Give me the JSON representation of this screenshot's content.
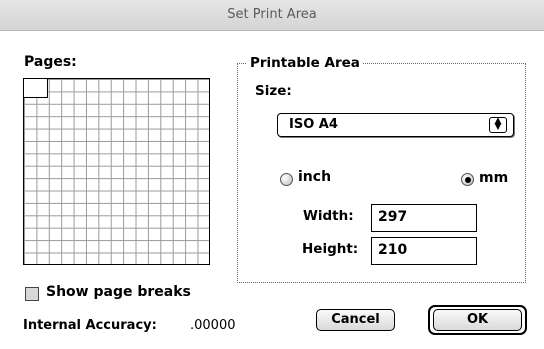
{
  "window": {
    "title": "Set Print Area"
  },
  "pages": {
    "label": "Pages:"
  },
  "printable_area": {
    "title": "Printable Area",
    "size_label": "Size:",
    "size_value": "ISO A4",
    "units": {
      "inch_label": "inch",
      "mm_label": "mm",
      "selected": "mm"
    },
    "width_label": "Width:",
    "width_value": "297",
    "height_label": "Height:",
    "height_value": "210"
  },
  "options": {
    "show_page_breaks_label": "Show page breaks",
    "show_page_breaks_checked": false,
    "internal_accuracy_label": "Internal Accuracy:",
    "internal_accuracy_value": ".00000"
  },
  "buttons": {
    "cancel": "Cancel",
    "ok": "OK"
  },
  "icons": {
    "popup_arrows": "up-down-arrows-icon"
  }
}
